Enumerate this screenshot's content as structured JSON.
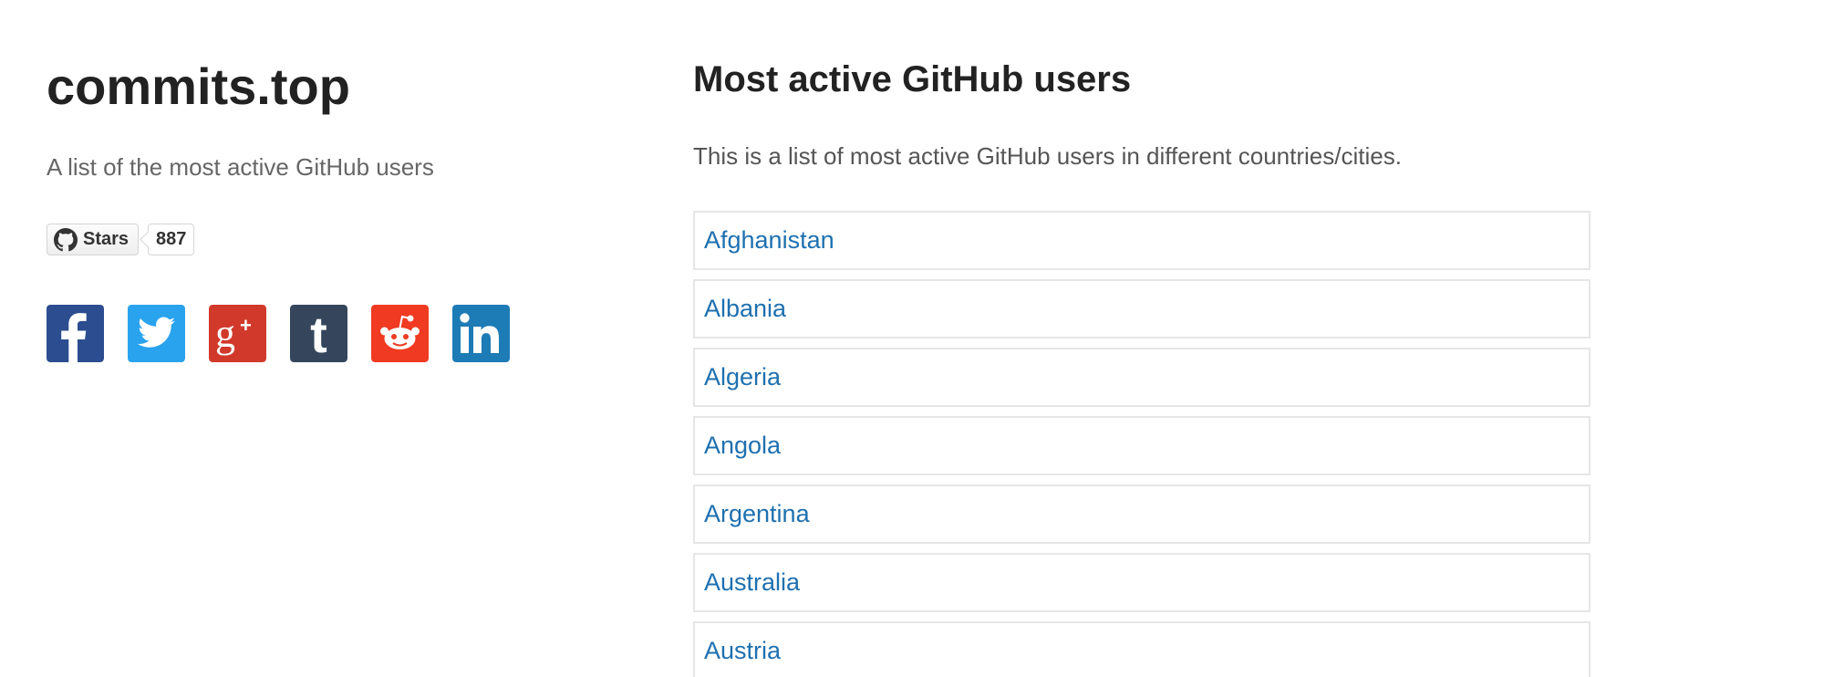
{
  "sidebar": {
    "title": "commits.top",
    "description": "A list of the most active GitHub users",
    "github_button": {
      "label": "Stars",
      "count": "887",
      "icon": "github-icon"
    },
    "share_buttons": [
      {
        "name": "facebook",
        "icon": "facebook-icon",
        "color": "#2c4d8f"
      },
      {
        "name": "twitter",
        "icon": "twitter-icon",
        "color": "#2aa3ef"
      },
      {
        "name": "google-plus",
        "icon": "google-plus-icon",
        "color": "#d1392b"
      },
      {
        "name": "tumblr",
        "icon": "tumblr-icon",
        "color": "#35465c"
      },
      {
        "name": "reddit",
        "icon": "reddit-icon",
        "color": "#f03a21"
      },
      {
        "name": "linkedin",
        "icon": "linkedin-icon",
        "color": "#1d7bb5"
      }
    ]
  },
  "main": {
    "title": "Most active GitHub users",
    "description": "This is a list of most active GitHub users in different countries/cities.",
    "countries": [
      {
        "label": "Afghanistan"
      },
      {
        "label": "Albania"
      },
      {
        "label": "Algeria"
      },
      {
        "label": "Angola"
      },
      {
        "label": "Argentina"
      },
      {
        "label": "Australia"
      },
      {
        "label": "Austria"
      }
    ]
  },
  "colors": {
    "link": "#1e70b0",
    "title": "#222222",
    "muted_text": "#666666",
    "list_border": "#e6e6e6"
  }
}
